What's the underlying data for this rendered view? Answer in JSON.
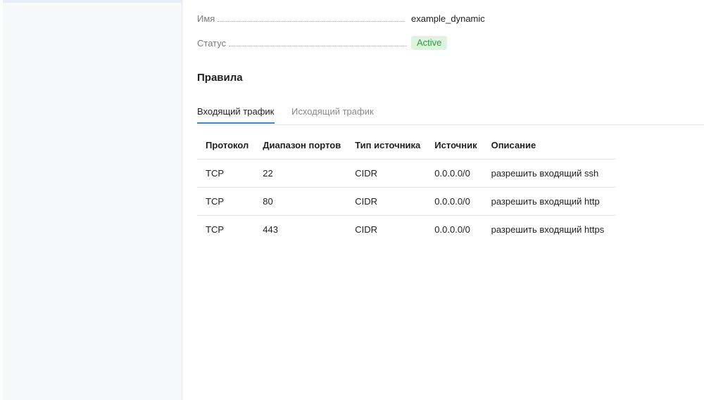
{
  "properties": {
    "name_label": "Имя",
    "name_value": "example_dynamic",
    "status_label": "Статус",
    "status_value": "Active"
  },
  "rules_section": {
    "title": "Правила",
    "tabs": [
      {
        "label": "Входящий трафик",
        "active": true
      },
      {
        "label": "Исходящий трафик",
        "active": false
      }
    ],
    "columns": [
      "Протокол",
      "Диапазон портов",
      "Тип источника",
      "Источник",
      "Описание"
    ],
    "rows": [
      [
        "TCP",
        "22",
        "CIDR",
        "0.0.0.0/0",
        "разрешить входящий ssh"
      ],
      [
        "TCP",
        "80",
        "CIDR",
        "0.0.0.0/0",
        "разрешить входящий http"
      ],
      [
        "TCP",
        "443",
        "CIDR",
        "0.0.0.0/0",
        "разрешить входящий https"
      ]
    ]
  },
  "colors": {
    "accent": "#3a86d8",
    "status_active_bg": "#def4e1",
    "status_active_text": "#2f9a3f",
    "sidebar_bg": "#f7f8fa"
  }
}
